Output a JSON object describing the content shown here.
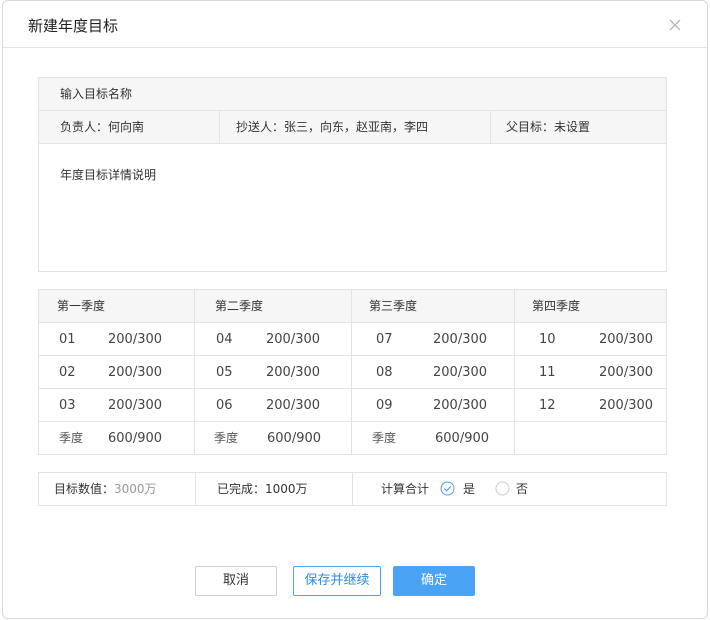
{
  "dialog": {
    "title": "新建年度目标",
    "close_icon": "close-icon"
  },
  "goal": {
    "name_placeholder": "输入目标名称",
    "owner": "负责人：何向南",
    "cc": "抄送人：张三，向东，赵亚南，李四",
    "parent": "父目标：未设置",
    "description": "年度目标详情说明"
  },
  "quarters": [
    {
      "title": "第一季度",
      "months": [
        {
          "month": "01",
          "value": "200/300"
        },
        {
          "month": "02",
          "value": "200/300"
        },
        {
          "month": "03",
          "value": "200/300"
        }
      ],
      "total_label": "季度",
      "total_value": "600/900"
    },
    {
      "title": "第二季度",
      "months": [
        {
          "month": "04",
          "value": "200/300"
        },
        {
          "month": "05",
          "value": "200/300"
        },
        {
          "month": "06",
          "value": "200/300"
        }
      ],
      "total_label": "季度",
      "total_value": "600/900"
    },
    {
      "title": "第三季度",
      "months": [
        {
          "month": "07",
          "value": "200/300"
        },
        {
          "month": "08",
          "value": "200/300"
        },
        {
          "month": "09",
          "value": "200/300"
        }
      ],
      "total_label": "季度",
      "total_value": "600/900"
    },
    {
      "title": "第四季度",
      "months": [
        {
          "month": "10",
          "value": "200/300"
        },
        {
          "month": "11",
          "value": "200/300"
        },
        {
          "month": "12",
          "value": "200/300"
        }
      ],
      "total_label": "",
      "total_value": ""
    }
  ],
  "summary": {
    "target_label": "目标数值：",
    "target_value": "3000万",
    "completed": "已完成：1000万",
    "calc_total_label": "计算合计",
    "option_yes": "是",
    "option_no": "否",
    "selected": "是"
  },
  "buttons": {
    "cancel": "取消",
    "save_continue": "保存并继续",
    "confirm": "确定"
  },
  "colors": {
    "primary": "#4ba3f5",
    "border": "#e3e3e3",
    "header_bg": "#f6f6f6"
  }
}
